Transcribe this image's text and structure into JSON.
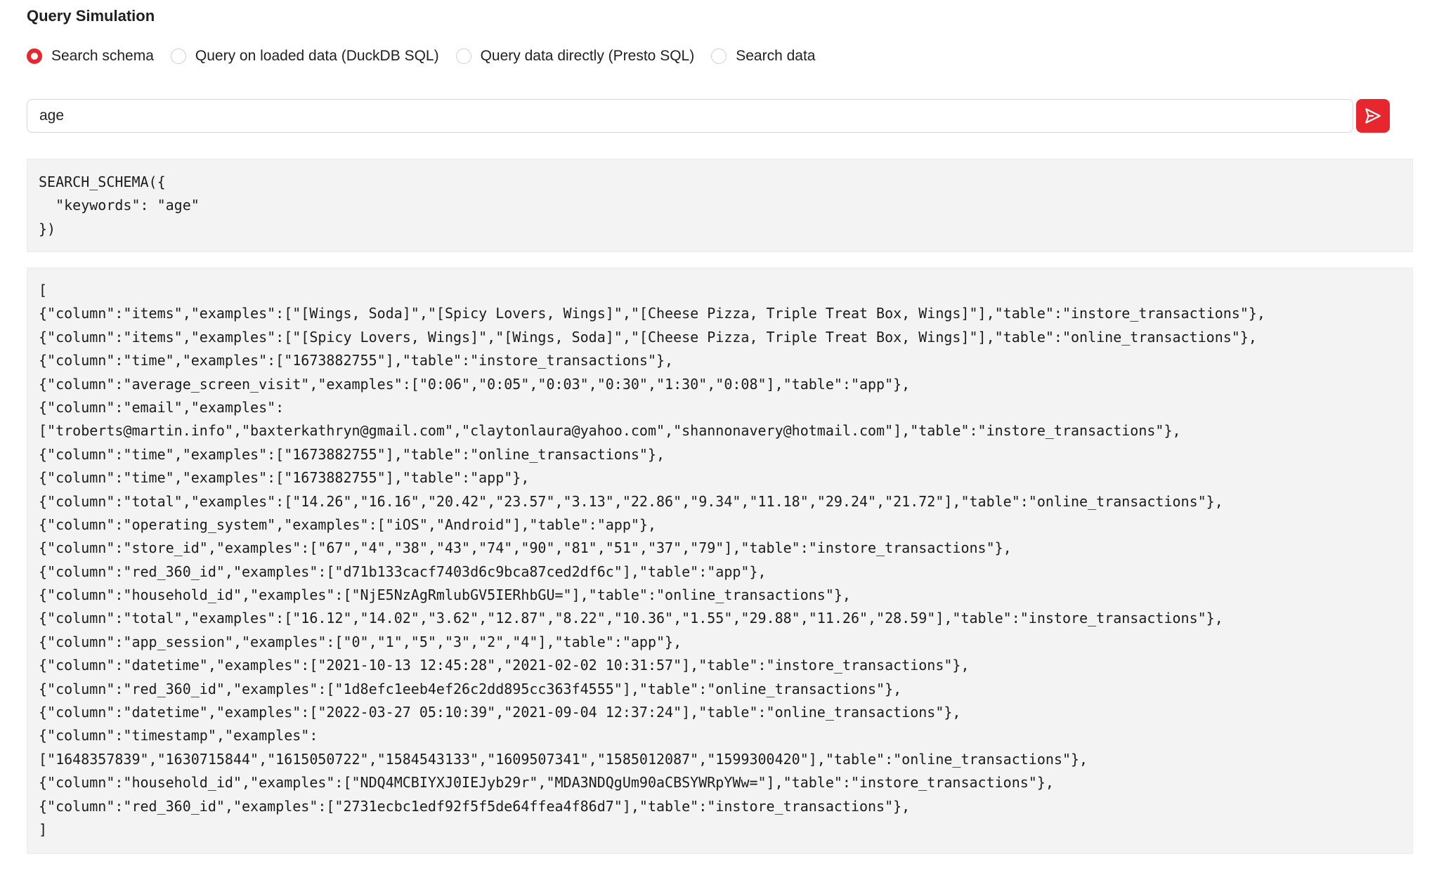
{
  "header": {
    "title": "Query Simulation"
  },
  "modes": [
    {
      "label": "Search schema",
      "selected": true
    },
    {
      "label": "Query on loaded data (DuckDB SQL)",
      "selected": false
    },
    {
      "label": "Query data directly (Presto SQL)",
      "selected": false
    },
    {
      "label": "Search data",
      "selected": false
    }
  ],
  "search": {
    "value": "age",
    "send_icon": "send-icon"
  },
  "accent_color": "#e8262e",
  "query": {
    "lines": [
      "SEARCH_SCHEMA({",
      "  \"keywords\": \"age\"",
      "})"
    ]
  },
  "result": {
    "lines": [
      "[",
      "{\"column\":\"items\",\"examples\":[\"[Wings, Soda]\",\"[Spicy Lovers, Wings]\",\"[Cheese Pizza, Triple Treat Box, Wings]\"],\"table\":\"instore_transactions\"},",
      "{\"column\":\"items\",\"examples\":[\"[Spicy Lovers, Wings]\",\"[Wings, Soda]\",\"[Cheese Pizza, Triple Treat Box, Wings]\"],\"table\":\"online_transactions\"},",
      "{\"column\":\"time\",\"examples\":[\"1673882755\"],\"table\":\"instore_transactions\"},",
      "{\"column\":\"average_screen_visit\",\"examples\":[\"0:06\",\"0:05\",\"0:03\",\"0:30\",\"1:30\",\"0:08\"],\"table\":\"app\"},",
      "{\"column\":\"email\",\"examples\":",
      "[\"troberts@martin.info\",\"baxterkathryn@gmail.com\",\"claytonlaura@yahoo.com\",\"shannonavery@hotmail.com\"],\"table\":\"instore_transactions\"},",
      "{\"column\":\"time\",\"examples\":[\"1673882755\"],\"table\":\"online_transactions\"},",
      "{\"column\":\"time\",\"examples\":[\"1673882755\"],\"table\":\"app\"},",
      "{\"column\":\"total\",\"examples\":[\"14.26\",\"16.16\",\"20.42\",\"23.57\",\"3.13\",\"22.86\",\"9.34\",\"11.18\",\"29.24\",\"21.72\"],\"table\":\"online_transactions\"},",
      "{\"column\":\"operating_system\",\"examples\":[\"iOS\",\"Android\"],\"table\":\"app\"},",
      "{\"column\":\"store_id\",\"examples\":[\"67\",\"4\",\"38\",\"43\",\"74\",\"90\",\"81\",\"51\",\"37\",\"79\"],\"table\":\"instore_transactions\"},",
      "{\"column\":\"red_360_id\",\"examples\":[\"d71b133cacf7403d6c9bca87ced2df6c\"],\"table\":\"app\"},",
      "{\"column\":\"household_id\",\"examples\":[\"NjE5NzAgRmlubGV5IERhbGU=\"],\"table\":\"online_transactions\"},",
      "{\"column\":\"total\",\"examples\":[\"16.12\",\"14.02\",\"3.62\",\"12.87\",\"8.22\",\"10.36\",\"1.55\",\"29.88\",\"11.26\",\"28.59\"],\"table\":\"instore_transactions\"},",
      "{\"column\":\"app_session\",\"examples\":[\"0\",\"1\",\"5\",\"3\",\"2\",\"4\"],\"table\":\"app\"},",
      "{\"column\":\"datetime\",\"examples\":[\"2021-10-13 12:45:28\",\"2021-02-02 10:31:57\"],\"table\":\"instore_transactions\"},",
      "{\"column\":\"red_360_id\",\"examples\":[\"1d8efc1eeb4ef26c2dd895cc363f4555\"],\"table\":\"online_transactions\"},",
      "{\"column\":\"datetime\",\"examples\":[\"2022-03-27 05:10:39\",\"2021-09-04 12:37:24\"],\"table\":\"online_transactions\"},",
      "{\"column\":\"timestamp\",\"examples\":",
      "[\"1648357839\",\"1630715844\",\"1615050722\",\"1584543133\",\"1609507341\",\"1585012087\",\"1599300420\"],\"table\":\"online_transactions\"},",
      "{\"column\":\"household_id\",\"examples\":[\"NDQ4MCBIYXJ0IEJyb29r\",\"MDA3NDQgUm90aCBSYWRpYWw=\"],\"table\":\"instore_transactions\"},",
      "{\"column\":\"red_360_id\",\"examples\":[\"2731ecbc1edf92f5f5de64ffea4f86d7\"],\"table\":\"instore_transactions\"},",
      "]"
    ]
  }
}
